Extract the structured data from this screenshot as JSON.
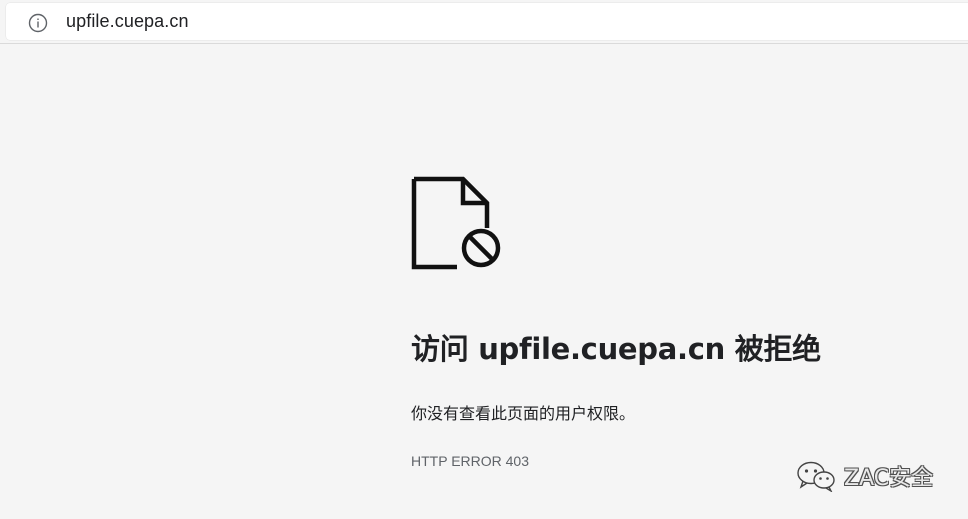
{
  "address_bar": {
    "url": "upfile.cuepa.cn",
    "icon": "info-icon"
  },
  "error_page": {
    "icon": "blocked-file-icon",
    "title": "访问 upfile.cuepa.cn 被拒绝",
    "message": "你没有查看此页面的用户权限。",
    "error_code": "HTTP ERROR 403"
  },
  "watermark": {
    "text": "ZAC安全",
    "icon": "wechat-icon"
  }
}
